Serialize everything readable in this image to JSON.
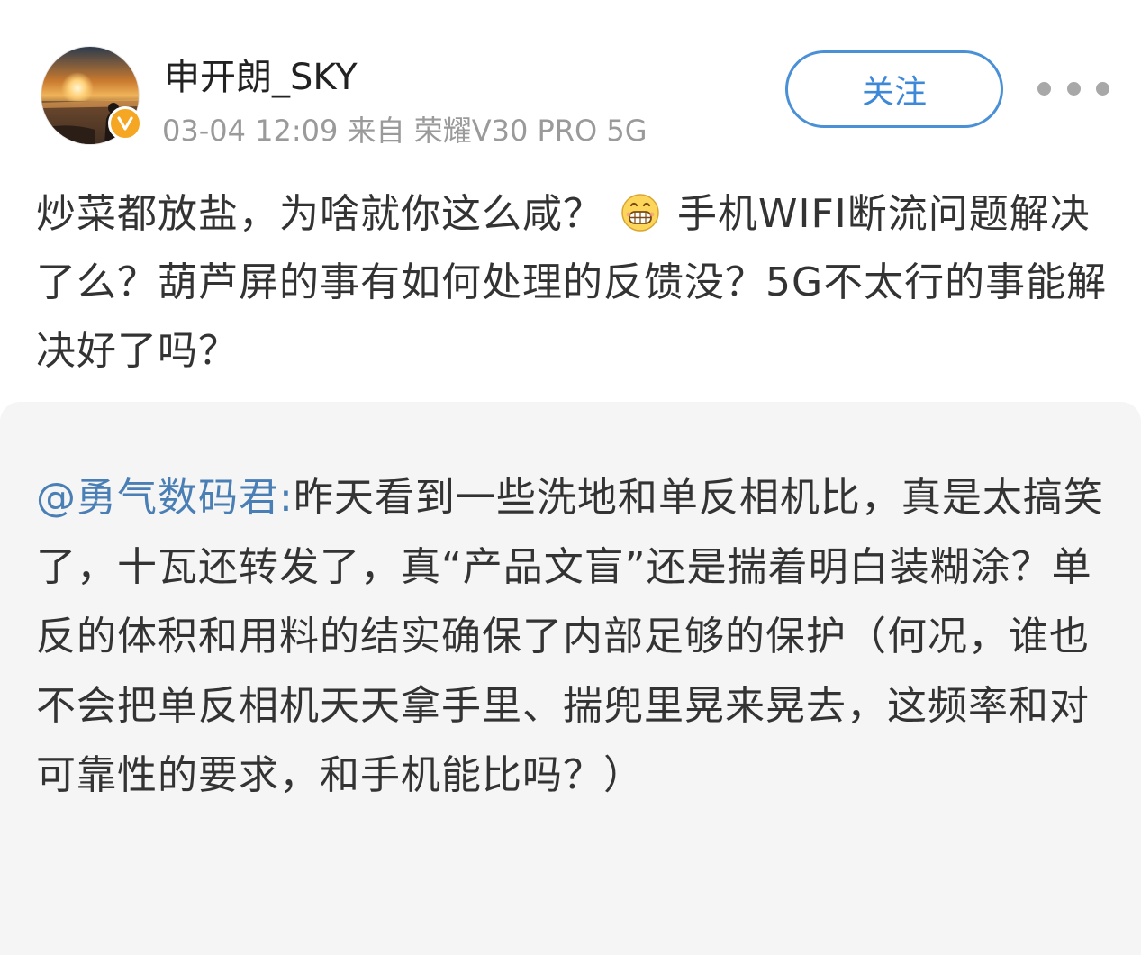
{
  "author": {
    "name": "申开朗_SKY",
    "meta": "03-04 12:09 来自 荣耀V30 PRO 5G",
    "verified": true,
    "badge_color": "#f5a623",
    "avatar_icon": "sunset-photo-avatar"
  },
  "actions": {
    "follow_label": "关注",
    "more_icon": "more-dots-icon",
    "accent_color": "#4a90d6"
  },
  "post": {
    "text_before_emoji": "炒菜都放盐，为啥就你这么咸？",
    "emoji_icon": "grin-emoji-icon",
    "text_after_emoji": "手机WIFI断流问题解决了么？葫芦屏的事有如何处理的反馈没？5G不太行的事能解决好了吗？"
  },
  "repost": {
    "mention": "@勇气数码君:",
    "mention_color": "#4a7fb5",
    "text": "昨天看到一些洗地和单反相机比，真是太搞笑了，十瓦还转发了，真“产品文盲”还是揣着明白装糊涂？单反的体积和用料的结实确保了内部足够的保护（何况，谁也不会把单反相机天天拿手里、揣兜里晃来晃去，这频率和对可靠性的要求，和手机能比吗？）",
    "background": "#f5f5f5"
  }
}
